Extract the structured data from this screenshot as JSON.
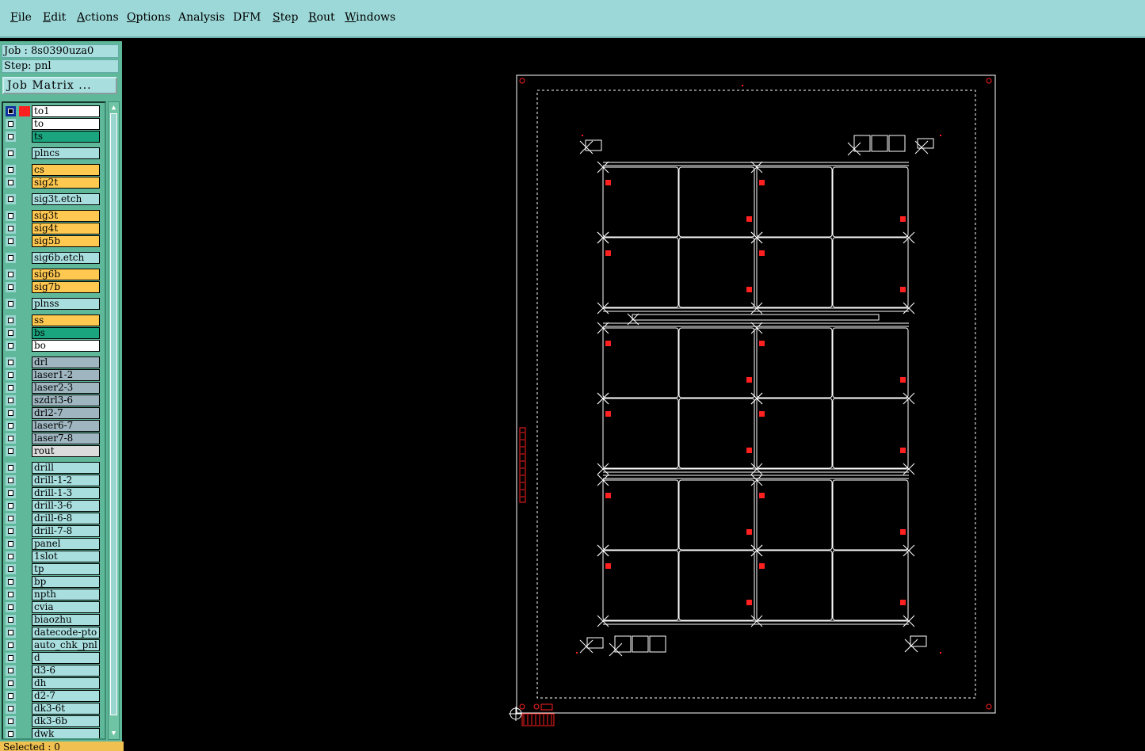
{
  "menubar": {
    "items": [
      {
        "label": "File",
        "ul": "F",
        "rest": "ile"
      },
      {
        "label": "Edit",
        "ul": "E",
        "rest": "dit"
      },
      {
        "label": "Actions",
        "ul": "A",
        "rest": "ctions"
      },
      {
        "label": "Options",
        "ul": "O",
        "rest": "ptions"
      },
      {
        "label": "Analysis",
        "ul": "",
        "rest": "Analysis"
      },
      {
        "label": "DFM",
        "ul": "",
        "rest": "DFM"
      },
      {
        "label": "Step",
        "ul": "S",
        "rest": "tep"
      },
      {
        "label": "Rout",
        "ul": "R",
        "rest": "out"
      },
      {
        "label": "Windows",
        "ul": "W",
        "rest": "indows"
      }
    ]
  },
  "panel": {
    "job": "Job : 8s0390uza0",
    "step": "Step: pnl",
    "job_matrix_button": "Job Matrix ...",
    "selected": "Selected : 0"
  },
  "colors": {
    "orange": "#ffc850",
    "teal_dark": "#1aa57e",
    "cyan": "#a8dede",
    "grey_blue": "#9fb6c0",
    "light_grey": "#dcdcdc",
    "white": "#ffffff",
    "red": "#ff2020",
    "outline": "#ffffff"
  },
  "layers": [
    {
      "name": "to1",
      "bg": "#ffffff",
      "gap": false,
      "active": true
    },
    {
      "name": "to",
      "bg": "#ffffff",
      "gap": false
    },
    {
      "name": "ts",
      "bg": "#1aa57e",
      "gap": false
    },
    {
      "name": "plncs",
      "bg": "#a8dede",
      "gap": true
    },
    {
      "name": "cs",
      "bg": "#ffc850",
      "gap": true
    },
    {
      "name": "sig2t",
      "bg": "#ffc850",
      "gap": false
    },
    {
      "name": "sig3t.etch",
      "bg": "#a8dede",
      "gap": true
    },
    {
      "name": "sig3t",
      "bg": "#ffc850",
      "gap": true
    },
    {
      "name": "sig4t",
      "bg": "#ffc850",
      "gap": false
    },
    {
      "name": "sig5b",
      "bg": "#ffc850",
      "gap": false
    },
    {
      "name": "sig6b.etch",
      "bg": "#a8dede",
      "gap": true
    },
    {
      "name": "sig6b",
      "bg": "#ffc850",
      "gap": true
    },
    {
      "name": "sig7b",
      "bg": "#ffc850",
      "gap": false
    },
    {
      "name": "plnss",
      "bg": "#a8dede",
      "gap": true
    },
    {
      "name": "ss",
      "bg": "#ffc850",
      "gap": true
    },
    {
      "name": "bs",
      "bg": "#1aa57e",
      "gap": false
    },
    {
      "name": "bo",
      "bg": "#ffffff",
      "gap": false
    },
    {
      "name": "drl",
      "bg": "#9fb6c0",
      "gap": true
    },
    {
      "name": "laser1-2",
      "bg": "#9fb6c0",
      "gap": false
    },
    {
      "name": "laser2-3",
      "bg": "#9fb6c0",
      "gap": false
    },
    {
      "name": "szdrl3-6",
      "bg": "#9fb6c0",
      "gap": false
    },
    {
      "name": "drl2-7",
      "bg": "#9fb6c0",
      "gap": false
    },
    {
      "name": "laser6-7",
      "bg": "#9fb6c0",
      "gap": false
    },
    {
      "name": "laser7-8",
      "bg": "#9fb6c0",
      "gap": false
    },
    {
      "name": "rout",
      "bg": "#dcdcdc",
      "gap": false
    },
    {
      "name": "drill",
      "bg": "#a8dede",
      "gap": true
    },
    {
      "name": "drill-1-2",
      "bg": "#a8dede",
      "gap": false
    },
    {
      "name": "drill-1-3",
      "bg": "#a8dede",
      "gap": false
    },
    {
      "name": "drill-3-6",
      "bg": "#a8dede",
      "gap": false
    },
    {
      "name": "drill-6-8",
      "bg": "#a8dede",
      "gap": false
    },
    {
      "name": "drill-7-8",
      "bg": "#a8dede",
      "gap": false
    },
    {
      "name": "panel",
      "bg": "#a8dede",
      "gap": false
    },
    {
      "name": "1slot",
      "bg": "#a8dede",
      "gap": false
    },
    {
      "name": "tp",
      "bg": "#a8dede",
      "gap": false
    },
    {
      "name": "bp",
      "bg": "#a8dede",
      "gap": false
    },
    {
      "name": "npth",
      "bg": "#a8dede",
      "gap": false
    },
    {
      "name": "cvia",
      "bg": "#a8dede",
      "gap": false
    },
    {
      "name": "biaozhu",
      "bg": "#a8dede",
      "gap": false
    },
    {
      "name": "datecode-pto",
      "bg": "#a8dede",
      "gap": false
    },
    {
      "name": "auto_chk_pnl",
      "bg": "#a8dede",
      "gap": false
    },
    {
      "name": "d",
      "bg": "#a8dede",
      "gap": false
    },
    {
      "name": "d3-6",
      "bg": "#a8dede",
      "gap": false
    },
    {
      "name": "dh",
      "bg": "#a8dede",
      "gap": false
    },
    {
      "name": "d2-7",
      "bg": "#a8dede",
      "gap": false
    },
    {
      "name": "dk3-6t",
      "bg": "#a8dede",
      "gap": false
    },
    {
      "name": "dk3-6b",
      "bg": "#a8dede",
      "gap": false
    },
    {
      "name": "dwk",
      "bg": "#a8dede",
      "gap": false
    }
  ],
  "board": {
    "rows": 6,
    "cols": 4,
    "groups": 3
  }
}
